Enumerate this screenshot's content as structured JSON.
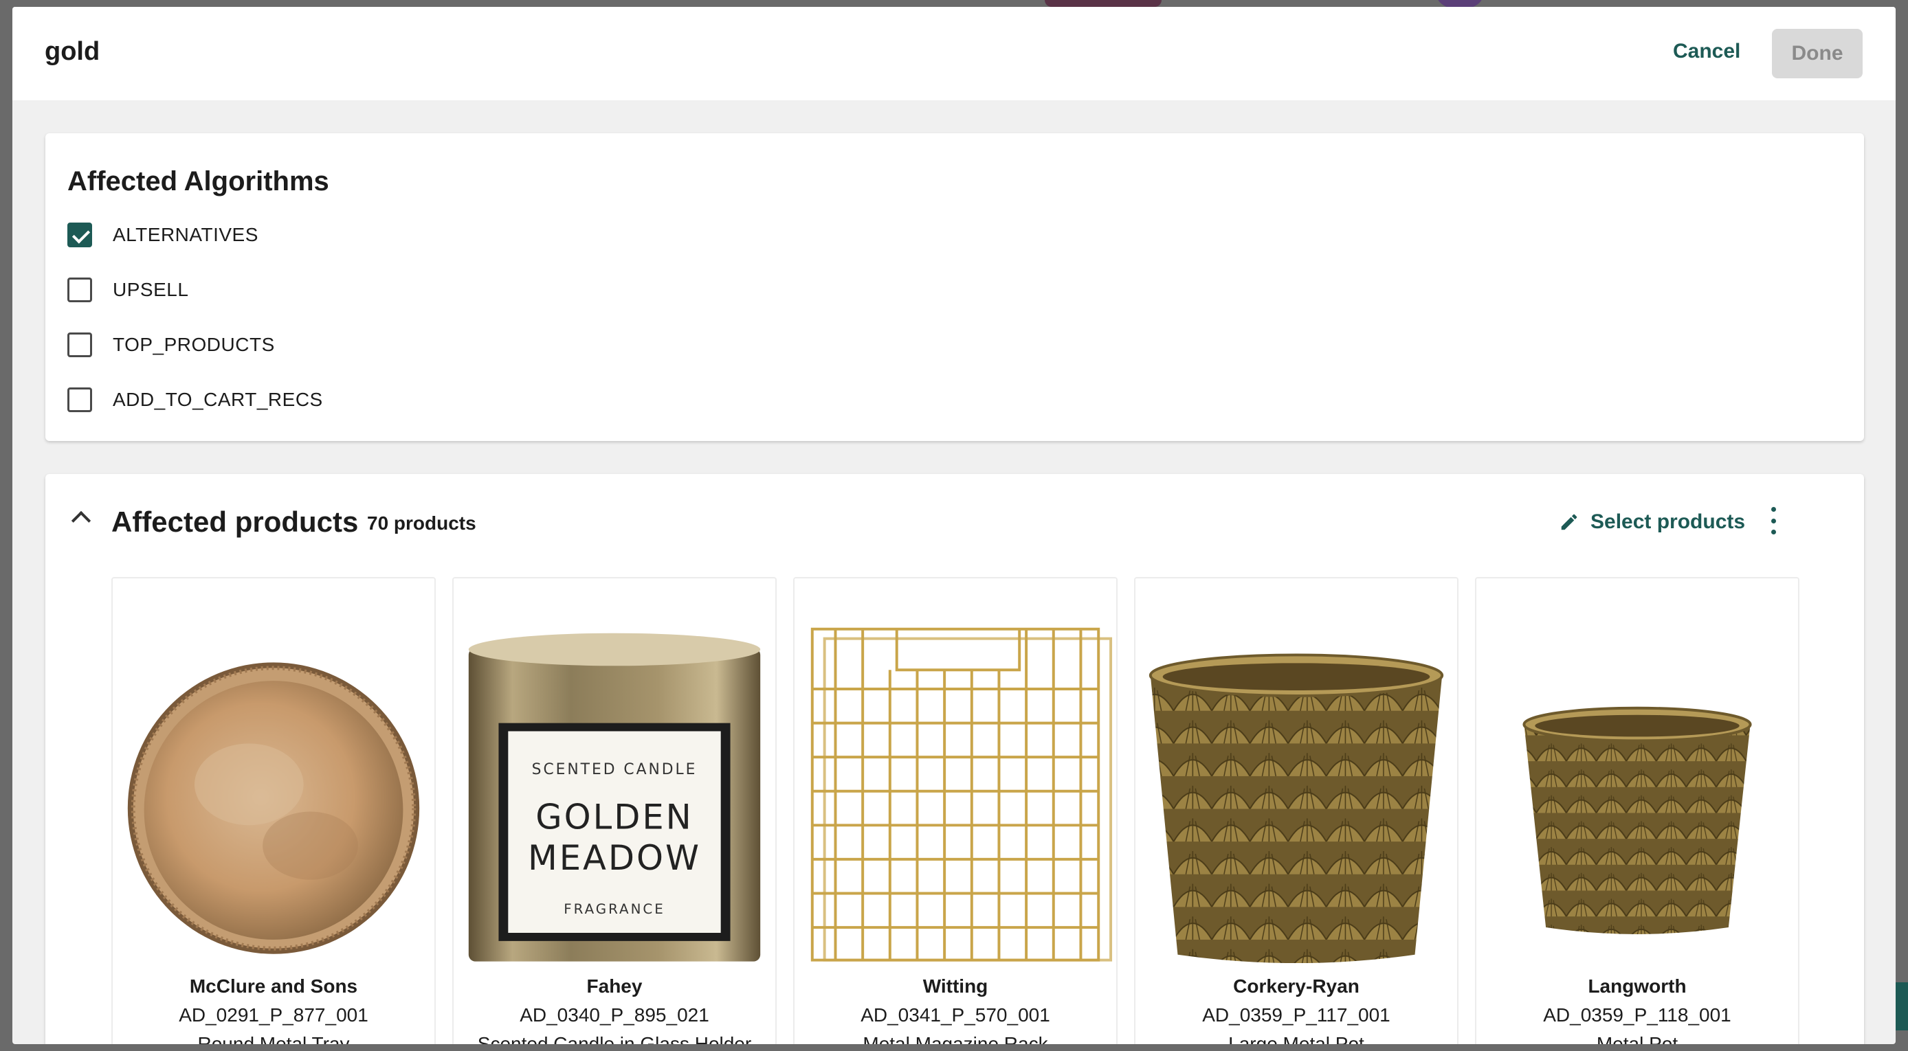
{
  "modal": {
    "title": "gold",
    "cancel_label": "Cancel",
    "done_label": "Done"
  },
  "algorithms": {
    "title": "Affected Algorithms",
    "items": [
      {
        "label": "ALTERNATIVES",
        "checked": true
      },
      {
        "label": "UPSELL",
        "checked": false
      },
      {
        "label": "TOP_PRODUCTS",
        "checked": false
      },
      {
        "label": "ADD_TO_CART_RECS",
        "checked": false
      }
    ]
  },
  "products": {
    "title": "Affected products",
    "count": "70 products",
    "select_label": "Select products",
    "items": [
      {
        "vendor": "McClure and Sons",
        "sku": "AD_0291_P_877_001",
        "name": "Round Metal Tray"
      },
      {
        "vendor": "Fahey",
        "sku": "AD_0340_P_895_021",
        "name": "Scented Candle in Glass Holder",
        "label_top": "SCENTED CANDLE",
        "label_line1": "GOLDEN",
        "label_line2": "MEADOW",
        "label_bottom": "FRAGRANCE"
      },
      {
        "vendor": "Witting",
        "sku": "AD_0341_P_570_001",
        "name": "Metal Magazine Rack"
      },
      {
        "vendor": "Corkery-Ryan",
        "sku": "AD_0359_P_117_001",
        "name": "Large Metal Pot"
      },
      {
        "vendor": "Langworth",
        "sku": "AD_0359_P_118_001",
        "name": "Metal Pot"
      }
    ]
  },
  "colors": {
    "accent": "#1d5a55",
    "done_bg": "#d9d9d9"
  }
}
